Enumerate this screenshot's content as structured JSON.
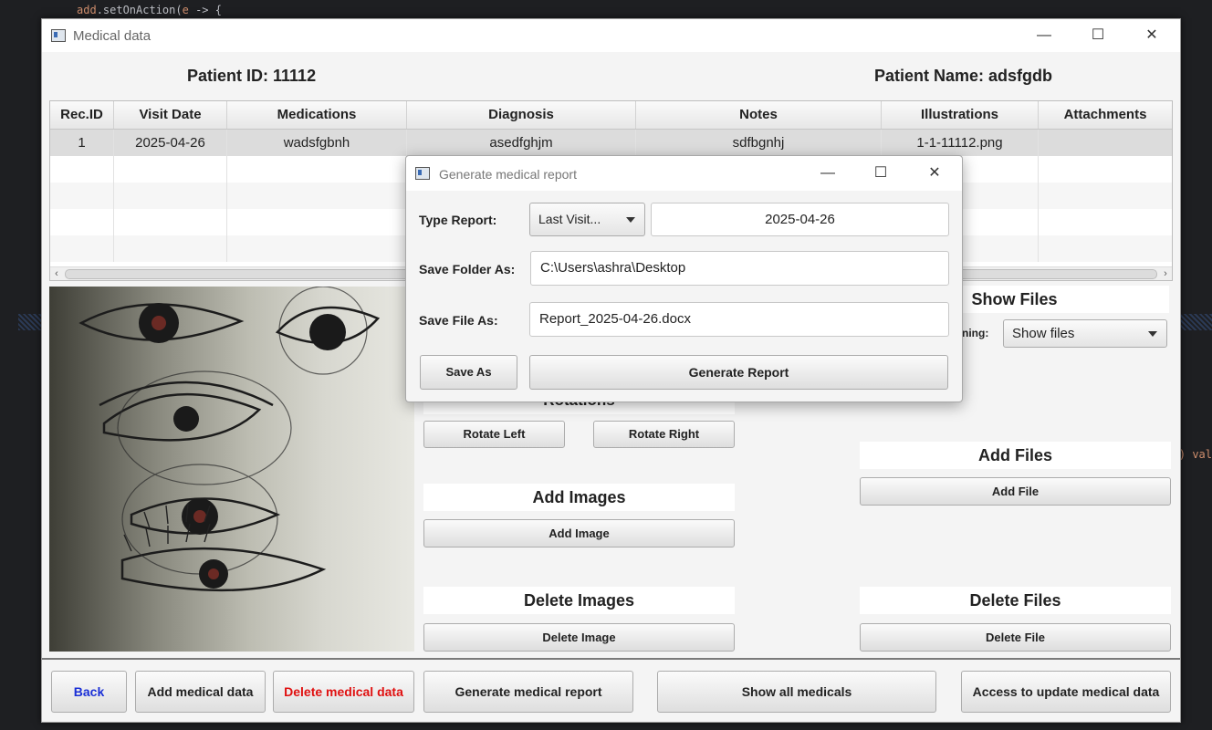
{
  "editor": {
    "code_prefix": "add",
    "code_method": ".setOnAction(",
    "code_param": "e",
    "code_suffix": " -> {",
    "code_right": ") val"
  },
  "window": {
    "title": "Medical data",
    "minimize": "—",
    "maximize": "☐",
    "close": "✕"
  },
  "patient": {
    "id_label": "Patient ID:  11112",
    "name_label": "Patient Name:  adsfgdb"
  },
  "table": {
    "columns": [
      "Rec.ID",
      "Visit Date",
      "Medications",
      "Diagnosis",
      "Notes",
      "Illustrations",
      "Attachments"
    ],
    "rows": [
      [
        "1",
        "2025-04-26",
        "wadsfgbnh",
        "asedfghjm",
        "sdfbgnhj",
        "1-1-11112.png",
        ""
      ]
    ],
    "scroll_left": "‹",
    "scroll_right": "›"
  },
  "images": {
    "rotations_title": "Rotations",
    "rotate_left": "Rotate Left",
    "rotate_right": "Rotate Right",
    "add_title": "Add Images",
    "add_button": "Add Image",
    "delete_title": "Delete Images",
    "delete_button": "Delete Image"
  },
  "files": {
    "show_title": "Show Files",
    "combo_label": "ning:",
    "combo_value": "Show files",
    "add_title": "Add Files",
    "add_button": "Add File",
    "delete_title": "Delete Files",
    "delete_button": "Delete File"
  },
  "bottom": {
    "back": "Back",
    "add": "Add medical data",
    "delete": "Delete medical data",
    "generate": "Generate medical report",
    "show_all": "Show all medicals",
    "access": "Access to update medical data"
  },
  "dialog": {
    "title": "Generate medical report",
    "type_label": "Type Report:",
    "type_value": "Last Visit...",
    "date_value": "2025-04-26",
    "folder_label": "Save Folder As:",
    "folder_value": "C:\\Users\\ashra\\Desktop",
    "file_label": "Save File As:",
    "file_value": "Report_2025-04-26.docx",
    "save_as": "Save As",
    "generate": "Generate Report"
  },
  "colors": {
    "back_text": "#1a2fd6",
    "delete_text": "#e01010"
  }
}
